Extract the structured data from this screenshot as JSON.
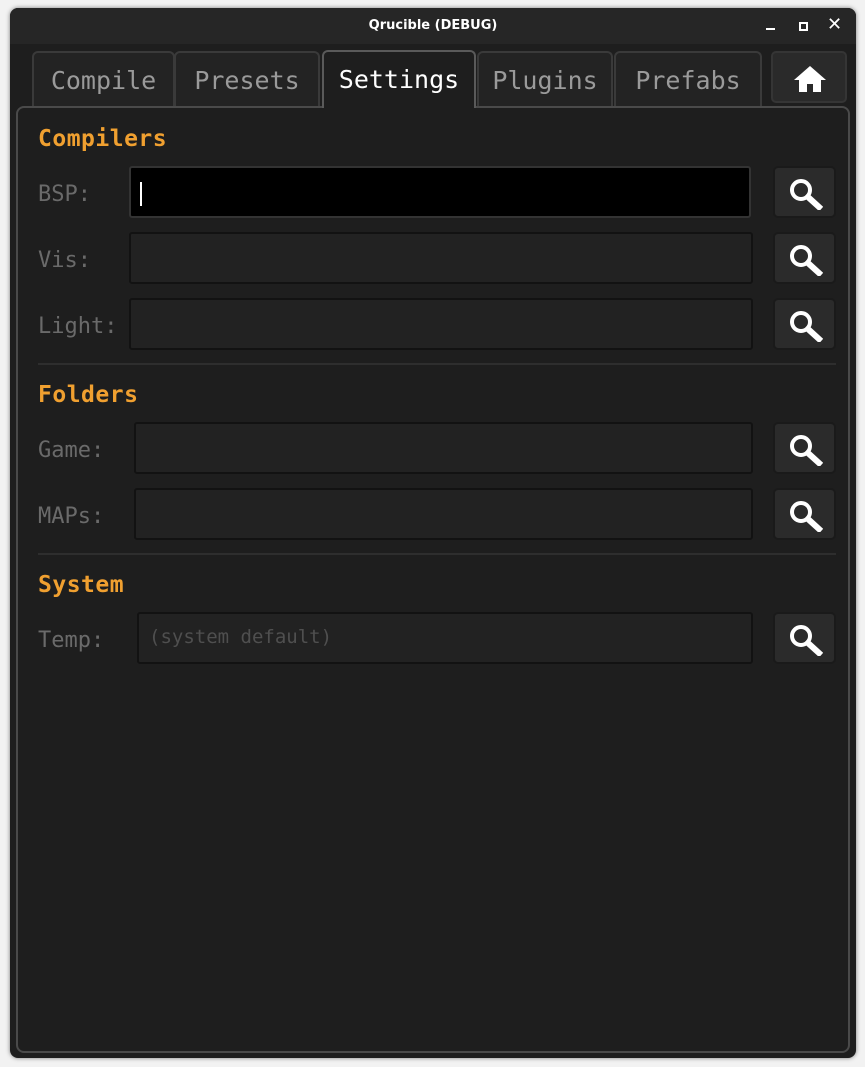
{
  "window": {
    "title": "Qrucible (DEBUG)"
  },
  "tabs": [
    {
      "label": "Compile"
    },
    {
      "label": "Presets"
    },
    {
      "label": "Settings"
    },
    {
      "label": "Plugins"
    },
    {
      "label": "Prefabs"
    }
  ],
  "active_tab": "Settings",
  "home_icon": "home-icon",
  "browse_icon": "magnifier-icon",
  "colors": {
    "section_title": "#f0a030",
    "label": "#6a6a6a",
    "background": "#1e1e1e"
  },
  "compilers": {
    "title": "Compilers",
    "bsp": {
      "label": "BSP:",
      "value": ""
    },
    "vis": {
      "label": "Vis:",
      "value": ""
    },
    "light": {
      "label": "Light:",
      "value": ""
    }
  },
  "folders": {
    "title": "Folders",
    "game": {
      "label": "Game:",
      "value": ""
    },
    "maps": {
      "label": "MAPs:",
      "value": ""
    }
  },
  "system": {
    "title": "System",
    "temp": {
      "label": "Temp:",
      "value": "",
      "placeholder": "(system default)"
    }
  }
}
